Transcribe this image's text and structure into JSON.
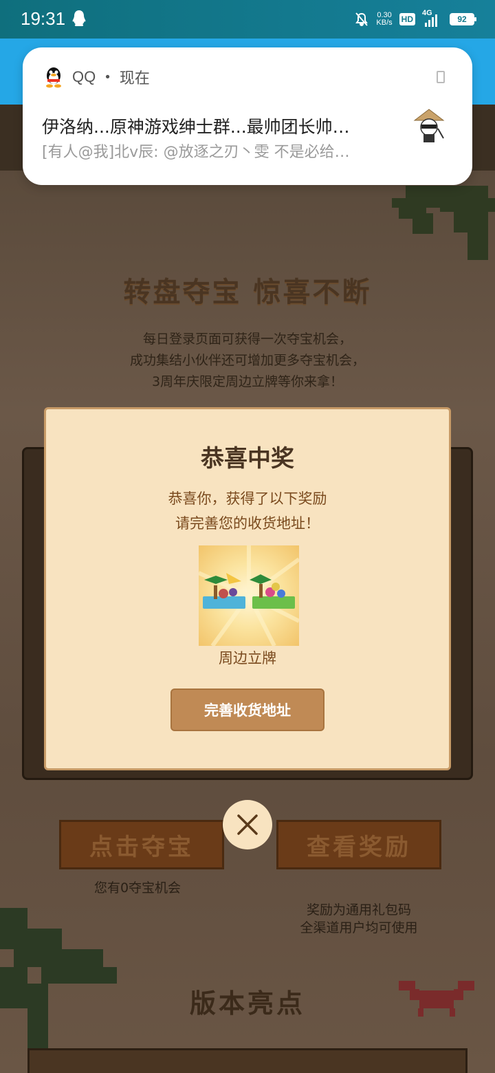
{
  "status_bar": {
    "time": "19:31",
    "net_speed_value": "0.30",
    "net_speed_unit": "KB/s",
    "hd_label": "HD",
    "network_label": "4G",
    "battery": "92"
  },
  "notification": {
    "app_name": "QQ",
    "separator": "•",
    "time": "现在",
    "title": "伊洛纳...原神游戏绅士群...最帅团长帅…",
    "body": "[有人@我]北v辰: @放逐之刃丶雯 不是必给…",
    "icon": "qq-penguin-icon",
    "avatar": "avatar-straw-hat-icon"
  },
  "page": {
    "hero_title": "转盘夺宝 惊喜不断",
    "hero_desc": [
      "每日登录页面可获得一次夺宝机会，",
      "成功集结小伙伴还可增加更多夺宝机会，",
      "3周年庆限定周边立牌等你来拿！"
    ],
    "draw_button": "点击夺宝",
    "view_rewards_button": "查看奖励",
    "chances_note": "您有0夺宝机会",
    "reward_note": [
      "奖励为通用礼包码",
      "全渠道用户均可使用"
    ],
    "section_title": "版本亮点"
  },
  "modal": {
    "title": "恭喜中奖",
    "lines": [
      "恭喜你，获得了以下奖励",
      "请完善您的收货地址！"
    ],
    "prize_name": "周边立牌",
    "button": "完善收货地址",
    "close_icon": "close-icon"
  },
  "colors": {
    "modal_bg": "#f8e3c0",
    "modal_button": "#c08a55",
    "header_blue": "#25a7e6",
    "title_text": "#4a3522"
  }
}
